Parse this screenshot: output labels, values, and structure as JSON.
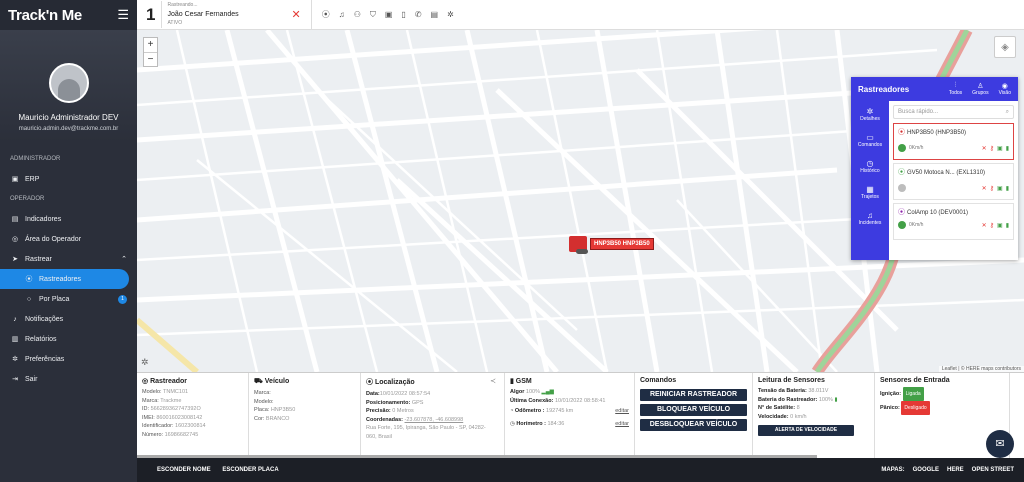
{
  "sidebar": {
    "logo": "Track'n Me",
    "user_name": "Mauricio Administrador DEV",
    "user_email": "mauricio.admin.dev@trackme.com.br",
    "section_admin": "ADMINISTRADOR",
    "section_operator": "OPERADOR",
    "items": {
      "erp": "ERP",
      "indicadores": "Indicadores",
      "area": "Área do Operador",
      "rastrear": "Rastrear",
      "rastreadores": "Rastreadores",
      "por_placa": "Por Placa",
      "por_placa_badge": "1",
      "notificacoes": "Notificações",
      "relatorios": "Relatórios",
      "preferencias": "Preferências",
      "sair": "Sair"
    }
  },
  "topbar": {
    "number": "1",
    "line1": "Rastreando...",
    "line2": "João Cesar Fernandes",
    "line3": "ATIVO"
  },
  "map": {
    "vehicle_label": "HNP3B50 HNP3B50",
    "attribution": "Leaflet | © HERE maps contributors"
  },
  "panel": {
    "title": "Rastreadores",
    "tabs": [
      "Todos",
      "Grupos",
      "Visão"
    ],
    "side": [
      "Detalhes",
      "Comandos",
      "Histórico",
      "Trajetos",
      "Incidentes"
    ],
    "search_placeholder": "Busca rápido...",
    "trackers": [
      {
        "name": "HNP3B50 (HNP3B50)",
        "speed": "0Km/h",
        "color": "#d32f2f",
        "status": "#43a047"
      },
      {
        "name": "GV50 Motoca N... (EXL1310)",
        "speed": "",
        "color": "#43a047",
        "status": "#bdbdbd"
      },
      {
        "name": "ColAmp 10 (DEV0001)",
        "speed": "0Km/h",
        "color": "#8e24aa",
        "status": "#43a047"
      }
    ]
  },
  "info": {
    "rastreador": {
      "title": "Rastreador",
      "modelo": "TNMC101",
      "marca": "Trackme",
      "id": "566289362747392O",
      "imei": "860016023008142",
      "identificador": "1602300814",
      "numero": "16986682745"
    },
    "veiculo": {
      "title": "Veículo",
      "marca": "",
      "modelo": "",
      "placa": "HNP3B50",
      "cor": "BRANCO"
    },
    "localizacao": {
      "title": "Localização",
      "data": "10/01/2022 08:57:54",
      "posicionamento": "GPS",
      "precisao": "0 Metros",
      "coordenadas": "-23.607878, -46.608998",
      "endereco": "Rua Forte, 195, Ipiranga, São Paulo - SP, 04282-060, Brasil"
    },
    "gsm": {
      "title": "GSM",
      "sinal": "100%",
      "ultima": "10/01/2022 08:58:41",
      "odometro": "192745 km",
      "horimetro": "184:36",
      "editar": "editar"
    },
    "comandos": {
      "title": "Comandos",
      "b1": "REINICIAR RASTREADOR",
      "b2": "BLOQUEAR VEÍCULO",
      "b3": "DESBLOQUEAR VEÍCULO"
    },
    "sensores": {
      "title": "Leitura de Sensores",
      "tensao": "38.011V",
      "bateria": "100%",
      "satelite": "8",
      "velocidade": "0 km/h",
      "alerta": "ALERTA DE VELOCIDADE"
    },
    "entrada": {
      "title": "Sensores de Entrada",
      "ignicao": "Ligada",
      "panico": "Desligado"
    }
  },
  "footer": {
    "esconder_nome": "ESCONDER NOME",
    "esconder_placa": "ESCONDER PLACA",
    "mapas": "MAPAS:",
    "google": "GOOGLE",
    "here": "HERE",
    "open": "OPEN STREET"
  }
}
